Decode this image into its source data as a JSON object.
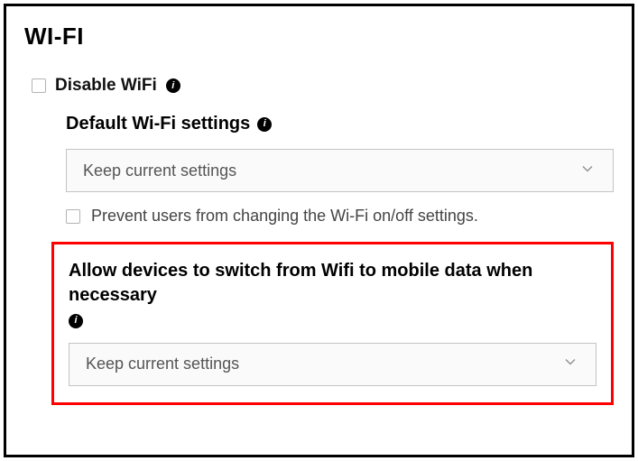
{
  "section": {
    "title": "WI-FI",
    "disable_label": "Disable WiFi",
    "default_heading": "Default Wi-Fi settings",
    "select1_value": "Keep current settings",
    "prevent_label": "Prevent users from changing the Wi-Fi on/off settings.",
    "switch_heading": "Allow devices to switch from Wifi to mobile data when necessary",
    "select2_value": "Keep current settings"
  },
  "icons": {
    "info": "i"
  }
}
